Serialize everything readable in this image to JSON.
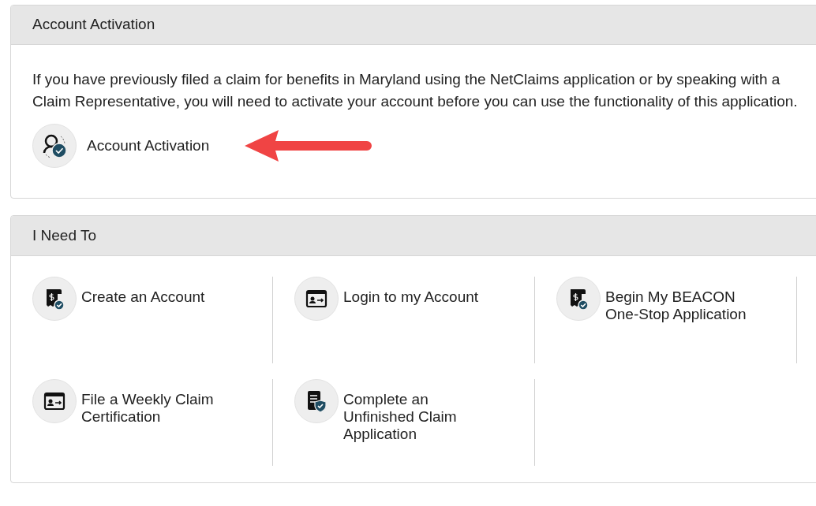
{
  "activation_panel": {
    "title": "Account Activation",
    "text": "If you have previously filed a claim for benefits in Maryland using the NetClaims application or by speaking with a Claim Representative, you will need to activate your account before you can use the functionality of this application.",
    "link": "Account Activation"
  },
  "actions_panel": {
    "title": "I Need To",
    "items": [
      {
        "label": "Create an Account",
        "kind": "receipt"
      },
      {
        "label": "Login to my Account",
        "kind": "card"
      },
      {
        "label": "Begin My BEACON One-Stop Application",
        "kind": "receipt"
      },
      {
        "label": "File a Weekly Claim Certification",
        "kind": "card"
      },
      {
        "label": "Complete an Unfinished Claim Application",
        "kind": "document"
      }
    ]
  }
}
